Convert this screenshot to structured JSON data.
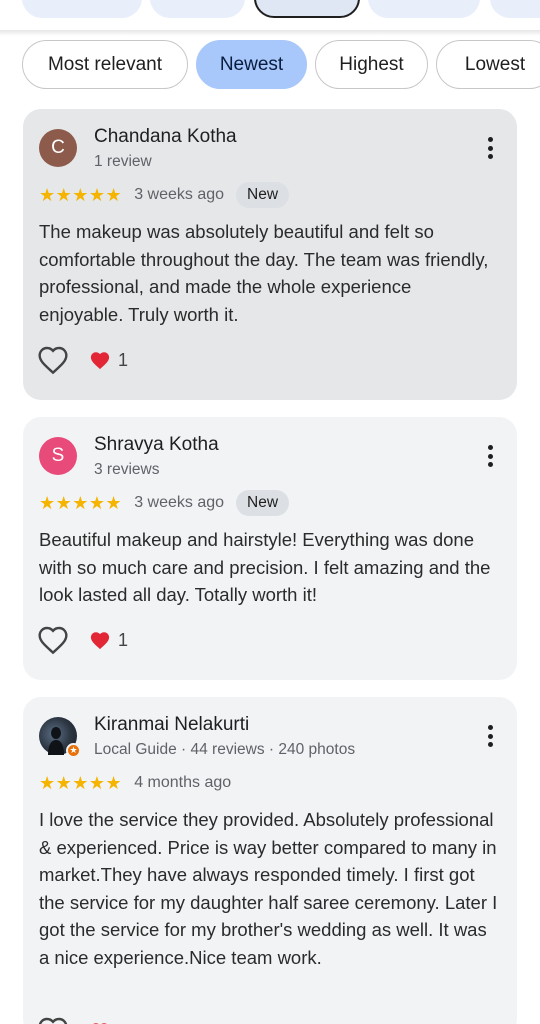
{
  "sort": {
    "options": [
      "Most relevant",
      "Newest",
      "Highest",
      "Lowest"
    ],
    "active": "Newest"
  },
  "reviews": [
    {
      "initial": "C",
      "avatar_color": "#8d5b4c",
      "name": "Chandana Kotha",
      "meta": "1 review",
      "stars": "★★★★★",
      "time": "3 weeks ago",
      "badge": "New",
      "text": "The makeup was absolutely beautiful and felt so comfortable throughout the day. The team was friendly, professional, and made the whole experience enjoyable. Truly worth it.",
      "reaction_count": "1"
    },
    {
      "initial": "S",
      "avatar_color": "#e84a7a",
      "name": "Shravya Kotha",
      "meta": "3 reviews",
      "stars": "★★★★★",
      "time": "3 weeks ago",
      "badge": "New",
      "text": "Beautiful makeup and hairstyle! Everything was done with so much care and precision. I felt amazing and the look lasted all day. Totally worth it!",
      "reaction_count": "1"
    },
    {
      "name": "Kiranmai Nelakurti",
      "meta": "Local Guide · 44 reviews · 240 photos",
      "stars": "★★★★★",
      "time": "4 months ago",
      "text": "I love the service they provided. Absolutely professional & experienced. Price is way better compared to many in market.They have always responded timely. I first got the service for my daughter half saree ceremony. Later I got the service for my brother's wedding as well. It was a nice experience.Nice team work."
    }
  ],
  "colors": {
    "active_chip": "#a8c7fa",
    "star": "#f5b400",
    "reaction_heart": "#e32636"
  },
  "icons": {
    "menu": "more-vert-icon",
    "like": "heart-outline-icon",
    "reaction": "red-heart-icon",
    "guide_badge": "local-guide-star-icon"
  }
}
